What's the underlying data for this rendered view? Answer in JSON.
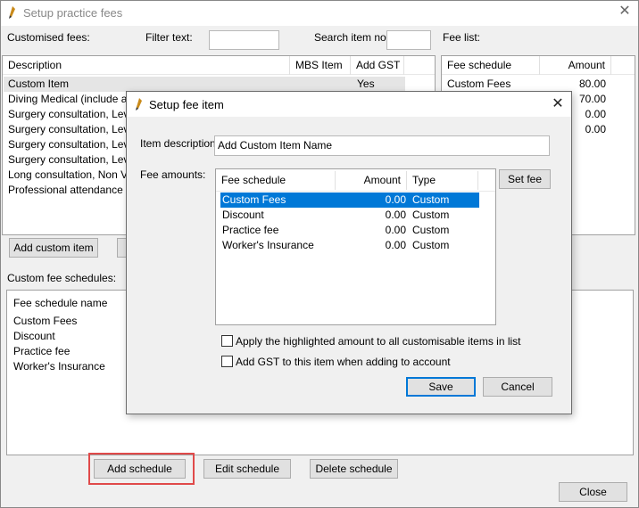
{
  "window": {
    "title": "Setup practice fees",
    "close_glyph": "✕"
  },
  "top": {
    "customised_fees_label": "Customised fees:",
    "filter_label": "Filter text:",
    "filter_value": "",
    "search_label": "Search item no:",
    "search_value": "",
    "fee_list_label": "Fee list:"
  },
  "fees_table": {
    "headers": [
      "Description",
      "MBS Item",
      "Add GST"
    ],
    "rows": [
      {
        "description": "Custom Item",
        "mbs": "",
        "gst": "Yes"
      },
      {
        "description": "Diving Medical (include an E",
        "mbs": "",
        "gst": ""
      },
      {
        "description": "Surgery consultation, Level",
        "mbs": "",
        "gst": ""
      },
      {
        "description": "Surgery consultation, Level C",
        "mbs": "",
        "gst": ""
      },
      {
        "description": "Surgery consultation, Level C",
        "mbs": "",
        "gst": ""
      },
      {
        "description": "Surgery consultation, Level",
        "mbs": "",
        "gst": ""
      },
      {
        "description": "Long consultation, Non VR",
        "mbs": "",
        "gst": ""
      },
      {
        "description": "Professional attendance by a",
        "mbs": "",
        "gst": ""
      }
    ]
  },
  "fee_list_table": {
    "headers": [
      "Fee schedule",
      "Amount"
    ],
    "rows": [
      {
        "schedule": "Custom Fees",
        "amount": "80.00"
      },
      {
        "schedule": "",
        "amount": "70.00"
      },
      {
        "schedule": "",
        "amount": "0.00"
      },
      {
        "schedule": "",
        "amount": "0.00"
      }
    ]
  },
  "buttons": {
    "add_custom_item": "Add custom item",
    "add_schedule": "Add schedule",
    "edit_schedule": "Edit schedule",
    "delete_schedule": "Delete schedule",
    "close": "Close"
  },
  "schedules": {
    "label": "Custom fee schedules:",
    "header": "Fee schedule name",
    "items": [
      "Custom Fees",
      "Discount",
      "Practice fee",
      "Worker's Insurance"
    ]
  },
  "dialog": {
    "title": "Setup fee item",
    "close_glyph": "✕",
    "item_description_label": "Item description:",
    "item_description_value": "Add Custom Item Name",
    "fee_amounts_label": "Fee amounts:",
    "set_fee_button": "Set fee",
    "table": {
      "headers": [
        "Fee schedule",
        "Amount",
        "Type"
      ],
      "rows": [
        {
          "schedule": "Custom Fees",
          "amount": "0.00",
          "type": "Custom"
        },
        {
          "schedule": "Discount",
          "amount": "0.00",
          "type": "Custom"
        },
        {
          "schedule": "Practice fee",
          "amount": "0.00",
          "type": "Custom"
        },
        {
          "schedule": "Worker's Insurance",
          "amount": "0.00",
          "type": "Custom"
        }
      ]
    },
    "apply_checkbox_label": "Apply the highlighted amount to all customisable items in list",
    "gst_checkbox_label": "Add GST to this item when adding to account",
    "save_button": "Save",
    "cancel_button": "Cancel"
  },
  "colors": {
    "selection": "#0078d7",
    "highlight_outline": "#e04a4a"
  }
}
